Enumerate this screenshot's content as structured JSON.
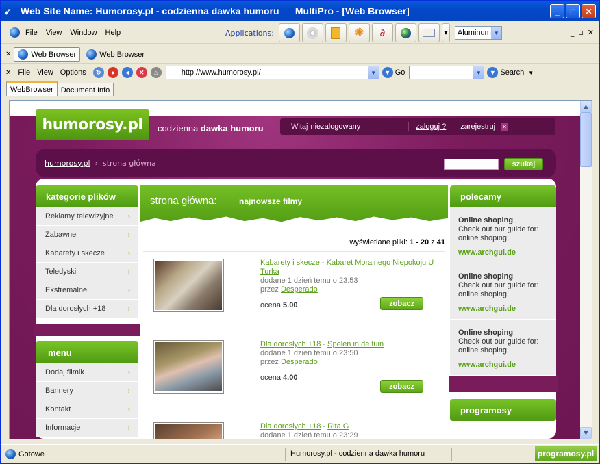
{
  "window": {
    "title": "Web Site Name: Humorosy.pl - codzienna dawka humoru      MultiPro - [Web Browser]",
    "minimize": "_",
    "maximize": "□",
    "close": "✕"
  },
  "menubar": {
    "items": [
      "File",
      "View",
      "Window",
      "Help"
    ],
    "applications_label": "Applications:",
    "theme_value": "Aluminum"
  },
  "browser_tabs": [
    "Web Browser",
    "Web Browser"
  ],
  "navbar": {
    "items": [
      "File",
      "View",
      "Options"
    ],
    "url": "http://www.humorosy.pl/",
    "go_label": "Go",
    "search_label": "Search"
  },
  "doc_tabs": [
    "WebBrowser",
    "Document Info"
  ],
  "site": {
    "logo_text": "humorosy.pl",
    "tagline_prefix": "codzienna ",
    "tagline_bold": "dawka humoru",
    "welcome": "Witaj",
    "user_status": "niezalogowany",
    "login_link": "zaloguj ?",
    "register_link": "zarejestruj",
    "crumb_home": "humorosy.pl",
    "crumb_sep": "›",
    "crumb_current": "strona główna",
    "search_button": "szukaj",
    "categories_title": "kategorie plików",
    "categories": [
      "Reklamy telewizyjne",
      "Zabawne",
      "Kabarety i skecze",
      "Teledyski",
      "Ekstremalne",
      "Dla dorosłych +18"
    ],
    "menu_title": "menu",
    "menu_items": [
      "Dodaj filmik",
      "Bannery",
      "Kontakt",
      "Informacje"
    ],
    "main_title": "strona główna:",
    "main_subtitle": "najnowsze filmy",
    "count_prefix": "wyświetlane pliki:",
    "count_range": "1 - 20",
    "count_of": "z",
    "count_total": "41",
    "movies": [
      {
        "category": "Kabarety i skecze",
        "title": "Kabaret Moralnego Niepokoju U Turka",
        "added": "dodane 1 dzień temu o 23:53",
        "by_label": "przez",
        "author": "Desperado",
        "rating_label": "ocena",
        "rating": "5.00",
        "button": "zobacz"
      },
      {
        "category": "Dla dorosłych +18",
        "title": "Spelen in de tuin",
        "added": "dodane 1 dzień temu o 23:50",
        "by_label": "przez",
        "author": "Desperado",
        "rating_label": "ocena",
        "rating": "4.00",
        "button": "zobacz"
      },
      {
        "category": "Dla dorosłych +18",
        "title": "Rita G",
        "added": "dodane 1 dzień temu o 23:29",
        "by_label": "",
        "author": "",
        "rating_label": "",
        "rating": "",
        "button": ""
      }
    ],
    "polecamy_title": "polecamy",
    "promos": [
      {
        "title": "Online shoping",
        "line1": "Check out our guide for:",
        "line2": "online shoping",
        "link": "www.archgui.de"
      },
      {
        "title": "Online shoping",
        "line1": "Check out our guide for:",
        "line2": "online shoping",
        "link": "www.archgui.de"
      },
      {
        "title": "Online shoping",
        "line1": "Check out our guide for:",
        "line2": "online shoping",
        "link": "www.archgui.de"
      }
    ],
    "programosy_title": "programosy"
  },
  "status": {
    "ready": "Gotowe",
    "page_title": "Humorosy.pl - codzienna dawka humoru",
    "brand": "programosy.pl"
  }
}
